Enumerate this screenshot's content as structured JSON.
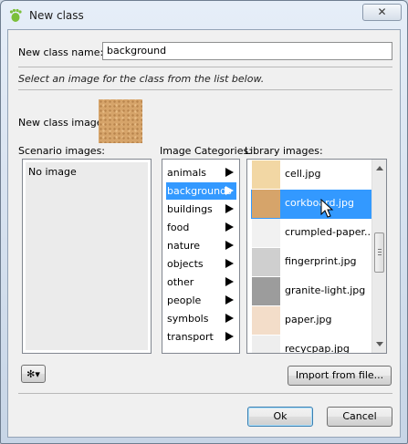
{
  "window": {
    "title": "New class",
    "close_glyph": "✕"
  },
  "form": {
    "name_label": "New class name:",
    "name_value": "background",
    "instruction": "Select an image for the class from the list below.",
    "image_label": "New class image:"
  },
  "columns": {
    "scenario": "Scenario images:",
    "categories": "Image Categories:",
    "library": "Library images:"
  },
  "scenario_images": [
    "No image"
  ],
  "categories": [
    {
      "label": "animals"
    },
    {
      "label": "backgrounds",
      "selected": true
    },
    {
      "label": "buildings"
    },
    {
      "label": "food"
    },
    {
      "label": "nature"
    },
    {
      "label": "objects"
    },
    {
      "label": "other"
    },
    {
      "label": "people"
    },
    {
      "label": "symbols"
    },
    {
      "label": "transport"
    }
  ],
  "library_images": [
    {
      "name": "cell.jpg",
      "color": "#f2d7a4"
    },
    {
      "name": "corkboard.jpg",
      "color": "#d6a46a",
      "selected": true
    },
    {
      "name": "crumpled-paper...",
      "color": "#f1f1f1"
    },
    {
      "name": "fingerprint.jpg",
      "color": "#cfcfcf"
    },
    {
      "name": "granite-light.jpg",
      "color": "#9c9c9c"
    },
    {
      "name": "paper.jpg",
      "color": "#f3ddc9"
    },
    {
      "name": "recycpap.jpg",
      "color": "#eeeeee"
    }
  ],
  "buttons": {
    "import": "Import from file...",
    "ok": "Ok",
    "cancel": "Cancel",
    "gear_glyph": "✻▾"
  },
  "colors": {
    "selection": "#3399ff"
  }
}
